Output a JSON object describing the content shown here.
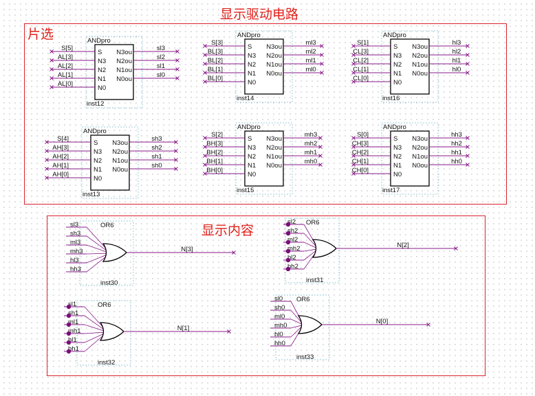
{
  "diagram_title": "显示驱动电路",
  "region_chip_select": {
    "title": "片选"
  },
  "region_display": {
    "title": "显示内容"
  },
  "colors": {
    "border": "#d8202a",
    "title": "#e0201a",
    "wire": "#8a1a8a",
    "pin": "#7a0e7a",
    "block": "#000000"
  },
  "and_blocks": [
    {
      "type": "ANDpro",
      "inst": "inst12",
      "in": [
        "S[5]",
        "AL[3]",
        "AL[2]",
        "AL[1]",
        "AL[0]"
      ],
      "out": [
        "sl3",
        "sl2",
        "sl1",
        "sl0"
      ]
    },
    {
      "type": "ANDpro",
      "inst": "inst14",
      "in": [
        "S[3]",
        "BL[3]",
        "BL[2]",
        "BL[1]",
        "BL[0]"
      ],
      "out": [
        "ml3",
        "ml2",
        "ml1",
        "ml0"
      ]
    },
    {
      "type": "ANDpro",
      "inst": "inst16",
      "in": [
        "S[1]",
        "CL[3]",
        "CL[2]",
        "CL[1]",
        "CL[0]"
      ],
      "out": [
        "hl3",
        "hl2",
        "hl1",
        "hl0"
      ]
    },
    {
      "type": "ANDpro",
      "inst": "inst13",
      "in": [
        "S[4]",
        "AH[3]",
        "AH[2]",
        "AH[1]",
        "AH[0]"
      ],
      "out": [
        "sh3",
        "sh2",
        "sh1",
        "sh0"
      ]
    },
    {
      "type": "ANDpro",
      "inst": "inst15",
      "in": [
        "S[2]",
        "BH[3]",
        "BH[2]",
        "BH[1]",
        "BH[0]"
      ],
      "out": [
        "mh3",
        "mh2",
        "mh1",
        "mh0"
      ]
    },
    {
      "type": "ANDpro",
      "inst": "inst17",
      "in": [
        "S[0]",
        "CH[3]",
        "CH[2]",
        "CH[1]",
        "CH[0]"
      ],
      "out": [
        "hh3",
        "hh2",
        "hh1",
        "hh0"
      ]
    }
  ],
  "and_pin_names": {
    "in": [
      "S",
      "N3",
      "N2",
      "N1",
      "N0"
    ],
    "out": [
      "N3ou",
      "N2ou",
      "N1ou",
      "N0ou"
    ]
  },
  "or_gates": [
    {
      "type": "OR6",
      "inst": "inst30",
      "in": [
        "sl3",
        "sh3",
        "ml3",
        "mh3",
        "hl3",
        "hh3"
      ],
      "out": "N[3]",
      "dots": false
    },
    {
      "type": "OR6",
      "inst": "inst31",
      "in": [
        "sl2",
        "sh2",
        "ml2",
        "mh2",
        "hl2",
        "hh2"
      ],
      "out": "N[2]",
      "dots": true
    },
    {
      "type": "OR6",
      "inst": "inst32",
      "in": [
        "sl1",
        "sh1",
        "ml1",
        "mh1",
        "hl1",
        "hh1"
      ],
      "out": "N[1]",
      "dots": true
    },
    {
      "type": "OR6",
      "inst": "inst33",
      "in": [
        "sl0",
        "sh0",
        "ml0",
        "mh0",
        "hl0",
        "hh0"
      ],
      "out": "N[0]",
      "dots": false
    }
  ]
}
